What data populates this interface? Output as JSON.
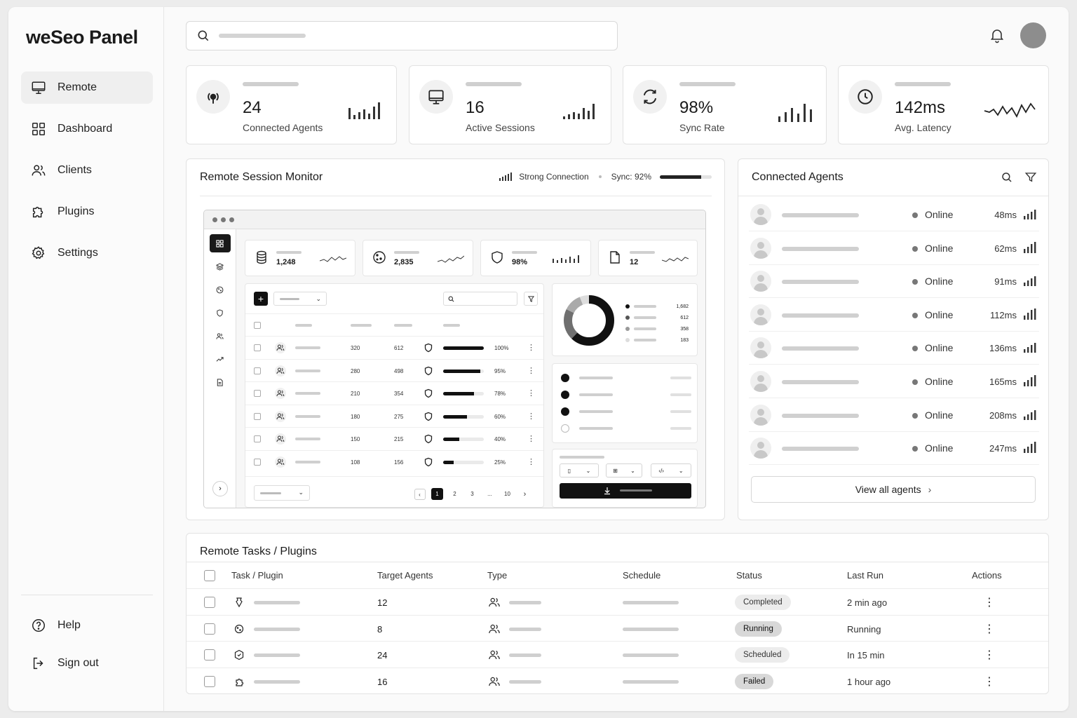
{
  "app": {
    "brand": "weSeo Panel"
  },
  "sidebar": {
    "items": [
      {
        "label": "Remote",
        "icon": "monitor-icon",
        "active": true
      },
      {
        "label": "Dashboard",
        "icon": "grid-icon"
      },
      {
        "label": "Clients",
        "icon": "users-icon"
      },
      {
        "label": "Plugins",
        "icon": "puzzle-icon"
      },
      {
        "label": "Settings",
        "icon": "gear-icon"
      }
    ],
    "bottom": [
      {
        "label": "Help",
        "icon": "help-icon"
      },
      {
        "label": "Sign out",
        "icon": "sign-out-icon"
      }
    ]
  },
  "stats": [
    {
      "value": "24",
      "label": "Connected Agents",
      "icon": "broadcast-icon"
    },
    {
      "value": "16",
      "label": "Active Sessions",
      "icon": "monitor-icon"
    },
    {
      "value": "98%",
      "label": "Sync Rate",
      "icon": "sync-icon"
    },
    {
      "value": "142ms",
      "label": "Avg. Latency",
      "icon": "clock-icon"
    }
  ],
  "monitor": {
    "title": "Remote Session Monitor",
    "connection": "Strong Connection",
    "sync_label": "Sync: 92%",
    "sync_fraction": 0.8,
    "mini_stats": [
      "1,248",
      "2,835",
      "98%",
      "12"
    ],
    "mini_rows": [
      {
        "a": "320",
        "b": "612",
        "pct": "100%",
        "fill": 1.0
      },
      {
        "a": "280",
        "b": "498",
        "pct": "95%",
        "fill": 0.92
      },
      {
        "a": "210",
        "b": "354",
        "pct": "78%",
        "fill": 0.76
      },
      {
        "a": "180",
        "b": "275",
        "pct": "60%",
        "fill": 0.58
      },
      {
        "a": "150",
        "b": "215",
        "pct": "40%",
        "fill": 0.4
      },
      {
        "a": "108",
        "b": "156",
        "pct": "25%",
        "fill": 0.26
      }
    ],
    "pagination": [
      "1",
      "2",
      "3",
      "...",
      "10"
    ],
    "donut_values": [
      "1,682",
      "612",
      "358",
      "183"
    ]
  },
  "agents": {
    "title": "Connected Agents",
    "rows": [
      {
        "status": "Online",
        "latency": "48ms"
      },
      {
        "status": "Online",
        "latency": "62ms"
      },
      {
        "status": "Online",
        "latency": "91ms"
      },
      {
        "status": "Online",
        "latency": "112ms"
      },
      {
        "status": "Online",
        "latency": "136ms"
      },
      {
        "status": "Online",
        "latency": "165ms"
      },
      {
        "status": "Online",
        "latency": "208ms"
      },
      {
        "status": "Online",
        "latency": "247ms"
      }
    ],
    "view_all": "View all agents"
  },
  "tasks": {
    "title": "Remote Tasks / Plugins",
    "headers": {
      "task": "Task / Plugin",
      "target": "Target Agents",
      "type": "Type",
      "schedule": "Schedule",
      "status": "Status",
      "last_run": "Last Run",
      "actions": "Actions"
    },
    "rows": [
      {
        "target": "12",
        "status": "Completed",
        "last_run": "2 min ago"
      },
      {
        "target": "8",
        "status": "Running",
        "last_run": "Running"
      },
      {
        "target": "24",
        "status": "Scheduled",
        "last_run": "In 15 min"
      },
      {
        "target": "16",
        "status": "Failed",
        "last_run": "1 hour ago"
      }
    ]
  }
}
